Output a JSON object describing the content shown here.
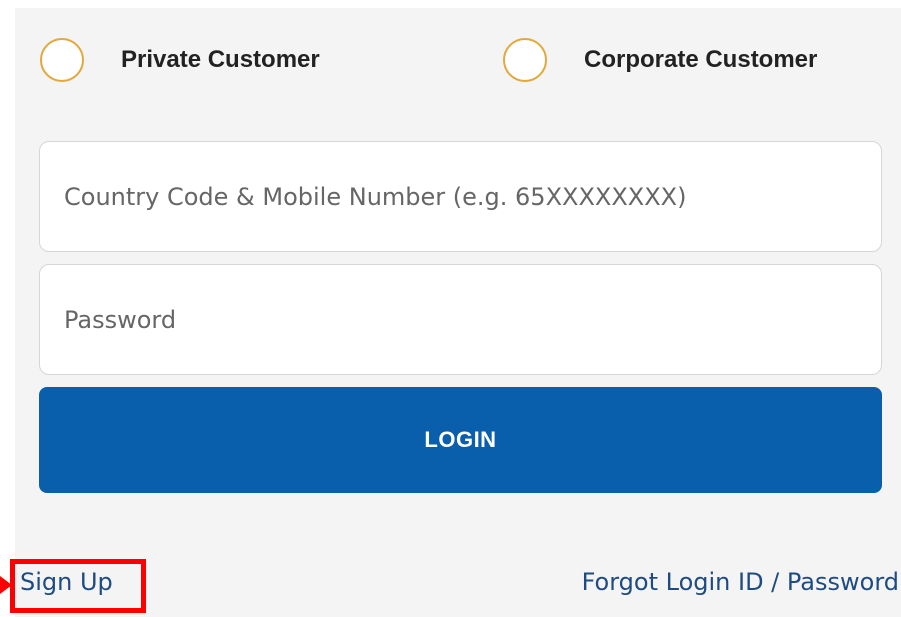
{
  "customer_type": {
    "options": [
      {
        "label": "Private Customer",
        "selected": false
      },
      {
        "label": "Corporate Customer",
        "selected": false
      }
    ],
    "radio_border_color": "#e2a83a"
  },
  "form": {
    "mobile_placeholder": "Country Code & Mobile Number (e.g. 65XXXXXXXX)",
    "mobile_value": "",
    "password_placeholder": "Password",
    "password_value": "",
    "login_label": "LOGIN",
    "login_color": "#0a5fad"
  },
  "links": {
    "sign_up": "Sign Up",
    "forgot": "Forgot Login ID / Password"
  },
  "annotation": {
    "highlight_color": "#ff0000",
    "highlight_target": "sign-up-link"
  }
}
